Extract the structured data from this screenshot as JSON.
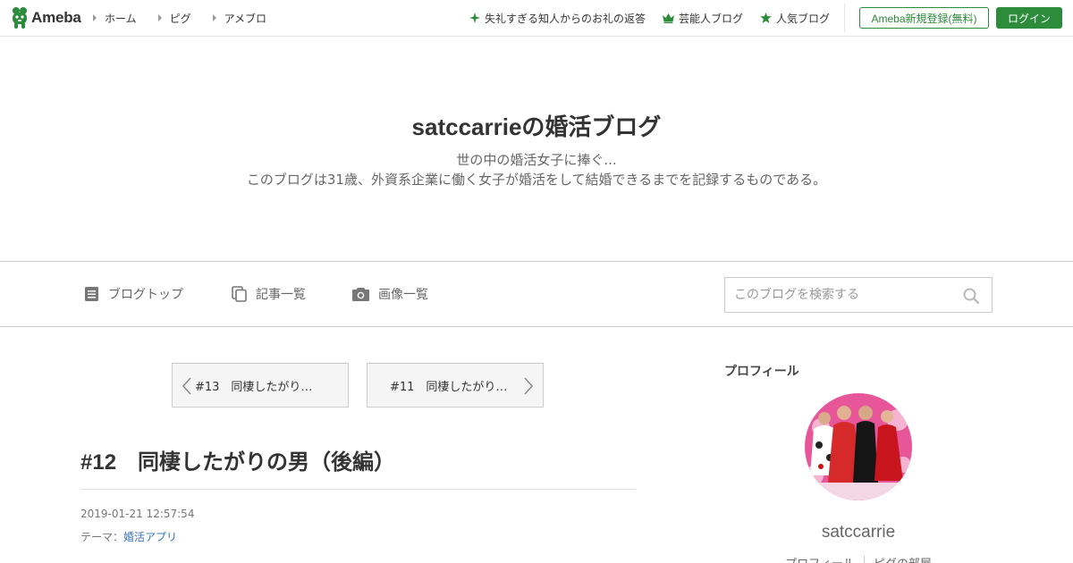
{
  "header": {
    "logo_text": "Ameba",
    "logo_icon": "ameba-mascot-icon",
    "nav_left": [
      {
        "label": "ホーム",
        "icon": "triangle-right-icon"
      },
      {
        "label": "ピグ",
        "icon": "triangle-right-icon"
      },
      {
        "label": "アメブロ",
        "icon": "triangle-right-icon"
      }
    ],
    "nav_right": [
      {
        "label": "失礼すぎる知人からのお礼の返答",
        "icon": "sparkle-icon"
      },
      {
        "label": "芸能人ブログ",
        "icon": "crown-icon"
      },
      {
        "label": "人気ブログ",
        "icon": "star-icon"
      }
    ],
    "register_label": "Ameba新規登録(無料)",
    "login_label": "ログイン"
  },
  "blog": {
    "title": "satccarrieの婚活ブログ",
    "description_line1": "世の中の婚活女子に捧ぐ...",
    "description_line2": "このブログは31歳、外資系企業に働く女子が婚活をして結婚できるまでを記録するものである。"
  },
  "blog_nav": {
    "items": [
      {
        "label": "ブログトップ",
        "icon": "document-icon"
      },
      {
        "label": "記事一覧",
        "icon": "copy-icon"
      },
      {
        "label": "画像一覧",
        "icon": "camera-icon"
      }
    ],
    "search_placeholder": "このブログを検索する",
    "search_icon": "search-icon"
  },
  "pager": {
    "prev_label": "#13　同棲したがり…",
    "next_label": "#11　同棲したがり…"
  },
  "entry": {
    "title": "#12　同棲したがりの男（後編）",
    "date": "2019-01-21 12:57:54",
    "theme_prefix": "テーマ：",
    "theme_link": "婚活アプリ"
  },
  "sidebar": {
    "heading": "プロフィール",
    "profile_name": "satccarrie",
    "links": [
      "プロフィール",
      "ピグの部屋"
    ]
  },
  "colors": {
    "brand_green": "#2d8c3c",
    "link_blue": "#3b73b9",
    "border": "#cccccc"
  }
}
